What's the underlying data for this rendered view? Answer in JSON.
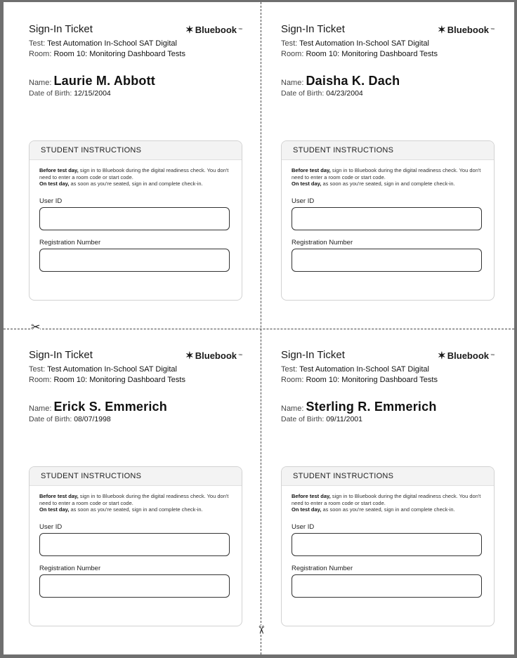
{
  "tickets": [
    {
      "title": "Sign-In Ticket",
      "brand": "Bluebook",
      "test_label": "Test: ",
      "test_value": "Test Automation In-School SAT Digital",
      "room_label": "Room: ",
      "room_value": "Room 10: Monitoring Dashboard Tests",
      "name_label": "Name: ",
      "name_value": "Laurie M. Abbott",
      "dob_label": "Date of Birth: ",
      "dob_value": "12/15/2004",
      "instructions_heading": "STUDENT INSTRUCTIONS",
      "before_bold": "Before test day,",
      "before_text": " sign in to Bluebook during the digital readiness check. You don't need to enter a room code or start code.",
      "on_bold": "On test day,",
      "on_text": " as soon as you're seated, sign in and complete check-in.",
      "user_id_label": "User ID",
      "user_id_value": "",
      "registration_label": "Registration Number",
      "registration_value": ""
    },
    {
      "title": "Sign-In Ticket",
      "brand": "Bluebook",
      "test_label": "Test: ",
      "test_value": "Test Automation In-School SAT Digital",
      "room_label": "Room: ",
      "room_value": "Room 10: Monitoring Dashboard Tests",
      "name_label": "Name: ",
      "name_value": "Daisha K. Dach",
      "dob_label": "Date of Birth: ",
      "dob_value": "04/23/2004",
      "instructions_heading": "STUDENT INSTRUCTIONS",
      "before_bold": "Before test day,",
      "before_text": " sign in to Bluebook during the digital readiness check. You don't need to enter a room code or start code.",
      "on_bold": "On test day,",
      "on_text": " as soon as you're seated, sign in and complete check-in.",
      "user_id_label": "User ID",
      "user_id_value": "",
      "registration_label": "Registration Number",
      "registration_value": ""
    },
    {
      "title": "Sign-In Ticket",
      "brand": "Bluebook",
      "test_label": "Test: ",
      "test_value": "Test Automation In-School SAT Digital",
      "room_label": "Room: ",
      "room_value": "Room 10: Monitoring Dashboard Tests",
      "name_label": "Name: ",
      "name_value": "Erick S. Emmerich",
      "dob_label": "Date of Birth: ",
      "dob_value": "08/07/1998",
      "instructions_heading": "STUDENT INSTRUCTIONS",
      "before_bold": "Before test day,",
      "before_text": " sign in to Bluebook during the digital readiness check. You don't need to enter a room code or start code.",
      "on_bold": "On test day,",
      "on_text": " as soon as you're seated, sign in and complete check-in.",
      "user_id_label": "User ID",
      "user_id_value": "",
      "registration_label": "Registration Number",
      "registration_value": ""
    },
    {
      "title": "Sign-In Ticket",
      "brand": "Bluebook",
      "test_label": "Test: ",
      "test_value": "Test Automation In-School SAT Digital",
      "room_label": "Room: ",
      "room_value": "Room 10: Monitoring Dashboard Tests",
      "name_label": "Name: ",
      "name_value": "Sterling R. Emmerich",
      "dob_label": "Date of Birth: ",
      "dob_value": "09/11/2001",
      "instructions_heading": "STUDENT INSTRUCTIONS",
      "before_bold": "Before test day,",
      "before_text": " sign in to Bluebook during the digital readiness check. You don't need to enter a room code or start code.",
      "on_bold": "On test day,",
      "on_text": " as soon as you're seated, sign in and complete check-in.",
      "user_id_label": "User ID",
      "user_id_value": "",
      "registration_label": "Registration Number",
      "registration_value": ""
    }
  ],
  "icons": {
    "brand": "bluebook-logo-icon",
    "cut": "scissors-icon"
  }
}
